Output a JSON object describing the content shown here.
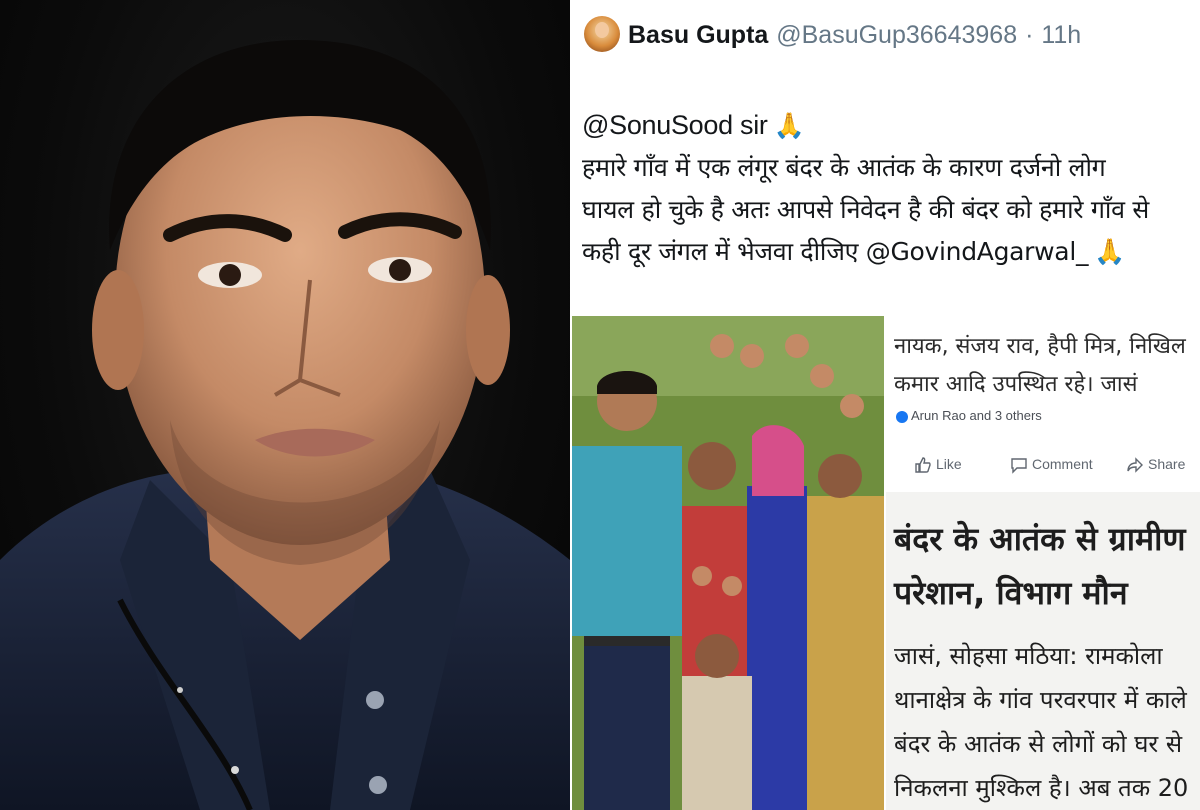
{
  "tweet": {
    "name": "Basu Gupta",
    "handle": "@BasuGup36643968",
    "separator": "·",
    "time": "11h",
    "lines": [
      "@SonuSood sir",
      "हमारे गाँव में एक लंगूर बंदर के आतंक के कारण दर्जनो लोग",
      "घायल हो चुके है अतः आपसे निवेदन है की बंदर को हमारे गाँव से",
      "कही दूर जंगल में भेजवा दीजिए @GovindAgarwal_"
    ],
    "emoji": "🙏"
  },
  "clipping": {
    "top_lines": [
      "नायक, संजय राव, हैपी मित्र, निखिल",
      "कमार आदि उपस्थित रहे। जासं"
    ],
    "reactions_text": "Arun Rao and 3 others",
    "actions": {
      "like": "Like",
      "comment": "Comment",
      "share": "Share"
    },
    "headline": [
      "बंदर के आतंक से ग्रामीण",
      "परेशान, विभाग मौन"
    ],
    "article": [
      "जासं, सोहसा मठिया: रामकोला",
      "थानाक्षेत्र के गांव परवरपार में काले",
      "बंदर के आतंक से लोगों को घर से",
      "निकलना मुश्किल है। अब तक 20"
    ]
  },
  "colors": {
    "portrait_bg": "#0b0b0b",
    "shirt": "#1a2233",
    "skin": "#c98f6d",
    "tweet_text": "#14171a",
    "tweet_meta": "#657786",
    "facebook_blue": "#1877f2"
  }
}
